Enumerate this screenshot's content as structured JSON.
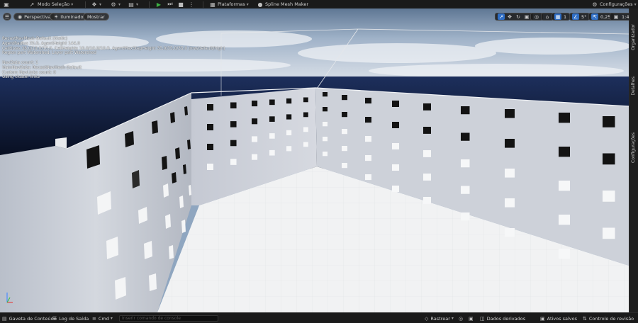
{
  "toolbar": {
    "mode_label": "Modo Seleção",
    "platforms_label": "Plataformas",
    "plugin_label": "Spline Mesh Maker",
    "settings_label": "Configurações"
  },
  "viewport": {
    "view_mode": "Perspectiva",
    "lighting": "Iluminado",
    "show": "Mostrar",
    "grid_snap_value": "1",
    "angle_snap_value": "5°",
    "scale_snap_value": "0,25",
    "camera_speed": "1",
    "camera_speed_suffix": "4"
  },
  "stats": {
    "lines": [
      "RecastNavMesh-Default (Static)",
      "AgentRadius 35,0, AgentHeight 144,0",
      "CellSizes 38,0/19,0/10,0, CellHeights 10,0/10,0/10,0, AgentMaxStepHeight 35,0/35,0/35,0 (low/default/high)",
      "Region part Watershed, Layer part Watershed",
      "",
      "NavData count: 1",
      "MainNavData: RecastNavMesh-Default",
      "Custom NavLinks count: 0",
      "Using cluster links"
    ]
  },
  "side_panel": {
    "tabs": [
      "Organizador",
      "Detalhes",
      "Configurações"
    ]
  },
  "statusbar": {
    "content_drawer": "Gaveta de Conteúdo",
    "output_log": "Log de Saída",
    "cmd": "Cmd",
    "console_placeholder": "Inserir comando de console",
    "trace": "Rastrear",
    "derived_data": "Dados derivados",
    "all_saved": "Ativos salvos",
    "revision_control": "Controle de revisão"
  },
  "colors": {
    "accent": "#2f6ec5",
    "play_green": "#3cb043",
    "wall": "#d9dce3",
    "floor": "#f2f3f4"
  }
}
